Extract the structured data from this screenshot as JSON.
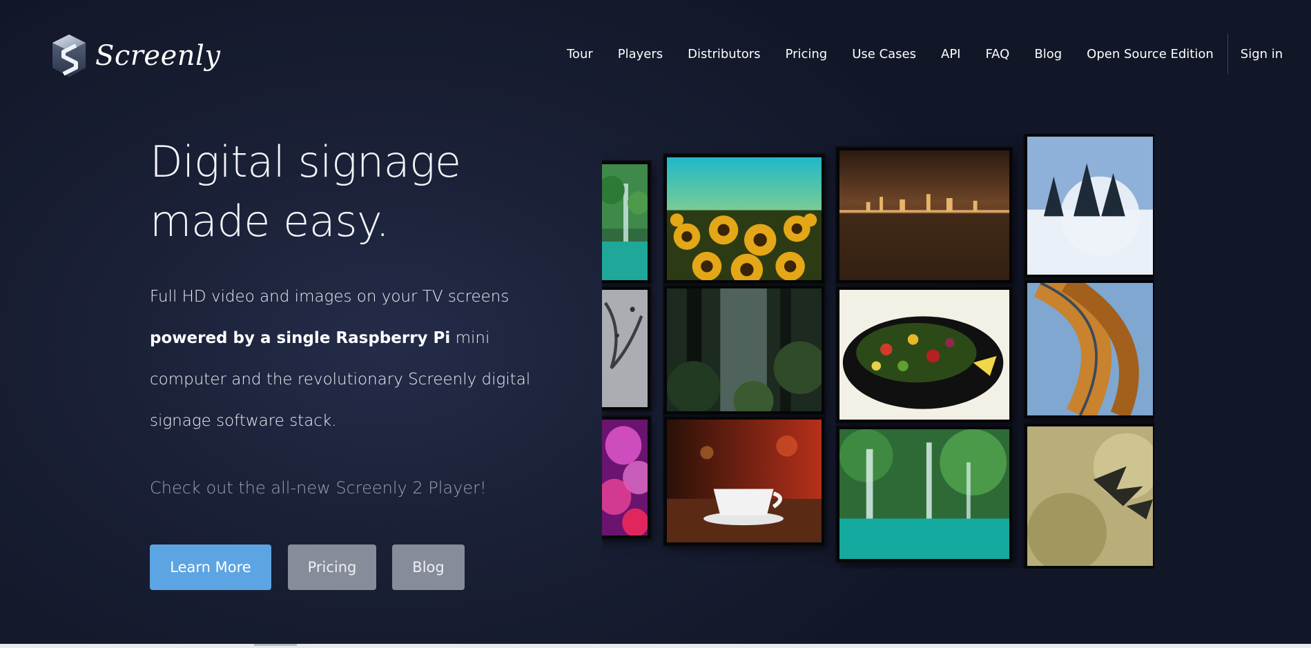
{
  "brand": {
    "name": "Screenly"
  },
  "nav": {
    "items": [
      {
        "label": "Tour"
      },
      {
        "label": "Players"
      },
      {
        "label": "Distributors"
      },
      {
        "label": "Pricing"
      },
      {
        "label": "Use Cases"
      },
      {
        "label": "API"
      },
      {
        "label": "FAQ"
      },
      {
        "label": "Blog"
      },
      {
        "label": "Open Source Edition"
      }
    ],
    "sign_in": "Sign in"
  },
  "hero": {
    "headline_line1": "Digital signage",
    "headline_line2": "made easy.",
    "lead_part1": "Full HD video and images on your TV screens",
    "lead_bold": "powered by a single Raspberry Pi",
    "lead_part2": "mini computer and the revolutionary Screenly digital signage software stack.",
    "promo_link": "Check out the all-new Screenly 2 Player!",
    "buttons": {
      "learn_more": "Learn More",
      "pricing": "Pricing",
      "blog": "Blog"
    }
  },
  "screen_wall": {
    "tiles": [
      {
        "subject": "waterfall-lagoon"
      },
      {
        "subject": "sunflower-field"
      },
      {
        "subject": "city-skyline-night"
      },
      {
        "subject": "snowy-trees"
      },
      {
        "subject": "water-splash"
      },
      {
        "subject": "misty-forest"
      },
      {
        "subject": "salad-bowl"
      },
      {
        "subject": "spiral-staircase"
      },
      {
        "subject": "bokeh-lights"
      },
      {
        "subject": "coffee-cup"
      },
      {
        "subject": "waterfall-lagoon"
      },
      {
        "subject": "birds-flight"
      }
    ]
  },
  "colors": {
    "background": "#181d31",
    "primary_button": "#5da4e3",
    "secondary_button": "#868c99",
    "promo_text": "#9aa3b5"
  }
}
